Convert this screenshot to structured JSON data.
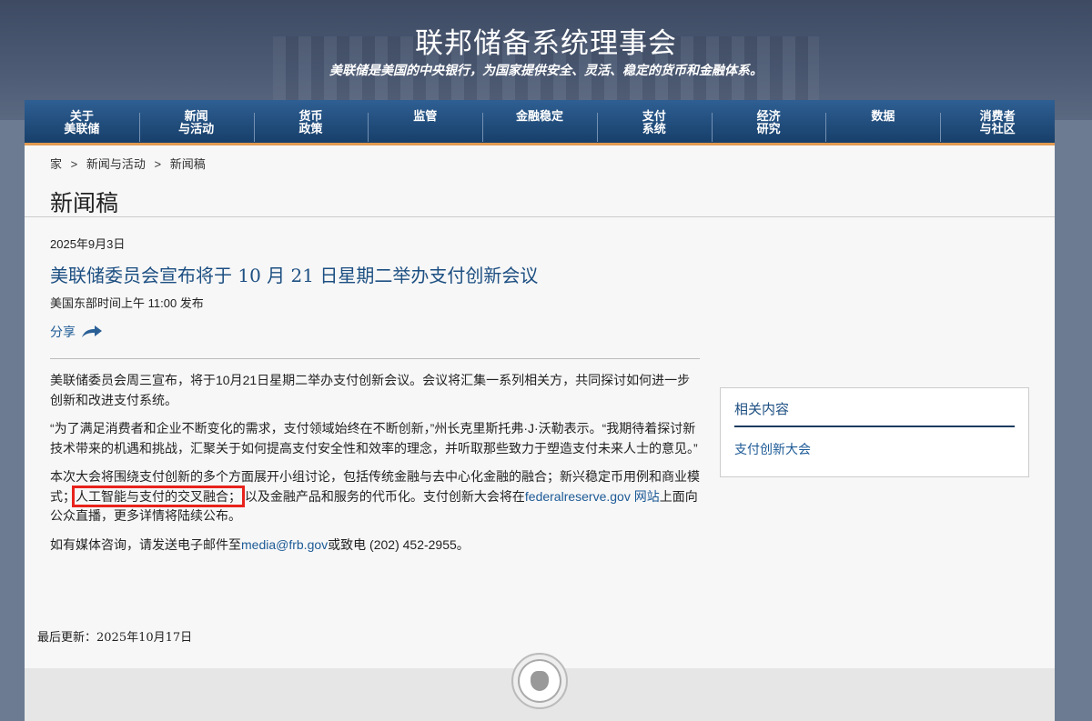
{
  "header": {
    "title": "联邦储备系统理事会",
    "tagline": "美联储是美国的中央银行，为国家提供安全、灵活、稳定的货币和金融体系。"
  },
  "nav": [
    [
      "关于",
      "美联储"
    ],
    [
      "新闻",
      "与活动"
    ],
    [
      "货币",
      "政策"
    ],
    [
      "监管",
      ""
    ],
    [
      "金融稳定",
      ""
    ],
    [
      "支付",
      "系统"
    ],
    [
      "经济",
      "研究"
    ],
    [
      "数据",
      ""
    ],
    [
      "消费者",
      "与社区"
    ]
  ],
  "breadcrumb": [
    "家",
    ">",
    "新闻与活动",
    ">",
    "新闻稿"
  ],
  "page_title": "新闻稿",
  "article": {
    "date": "2025年9月3日",
    "headline": "美联储委员会宣布将于 10 月 21 日星期二举办支付创新会议",
    "published": "美国东部时间上午 11:00 发布",
    "share": "分享",
    "p1": "美联储委员会周三宣布，将于10月21日星期二举办支付创新会议。会议将汇集一系列相关方，共同探讨如何进一步创新和改进支付系统。",
    "p2": "“为了满足消费者和企业不断变化的需求，支付领域始终在不断创新，”州长克里斯托弗·J·沃勒表示。“我期待着探讨新技术带来的机遇和挑战，汇聚关于如何提高支付安全性和效率的理念，并听取那些致力于塑造支付未来人士的意见。”",
    "p3a": "本次大会将围绕支付创新的多个方面展开小组讨论，包括传统金融与去中心化金融的融合；新兴稳定币用例和商业模式；",
    "p3_highlight": "人工智能与支付的交叉融合；",
    "p3b": "以及金融产品和服务的代币化。支付创新大会将在",
    "p3_link": "federalreserve.gov 网站",
    "p3c": "上面向公众直播，更多详情将陆续公布。",
    "p4a": "如有媒体咨询，请发送电子邮件至",
    "p4_link": "media@frb.gov",
    "p4b": "或致电 (202) 452-2955。"
  },
  "related": {
    "title": "相关内容",
    "link": "支付创新大会"
  },
  "last_updated": "最后更新：2025年10月17日"
}
